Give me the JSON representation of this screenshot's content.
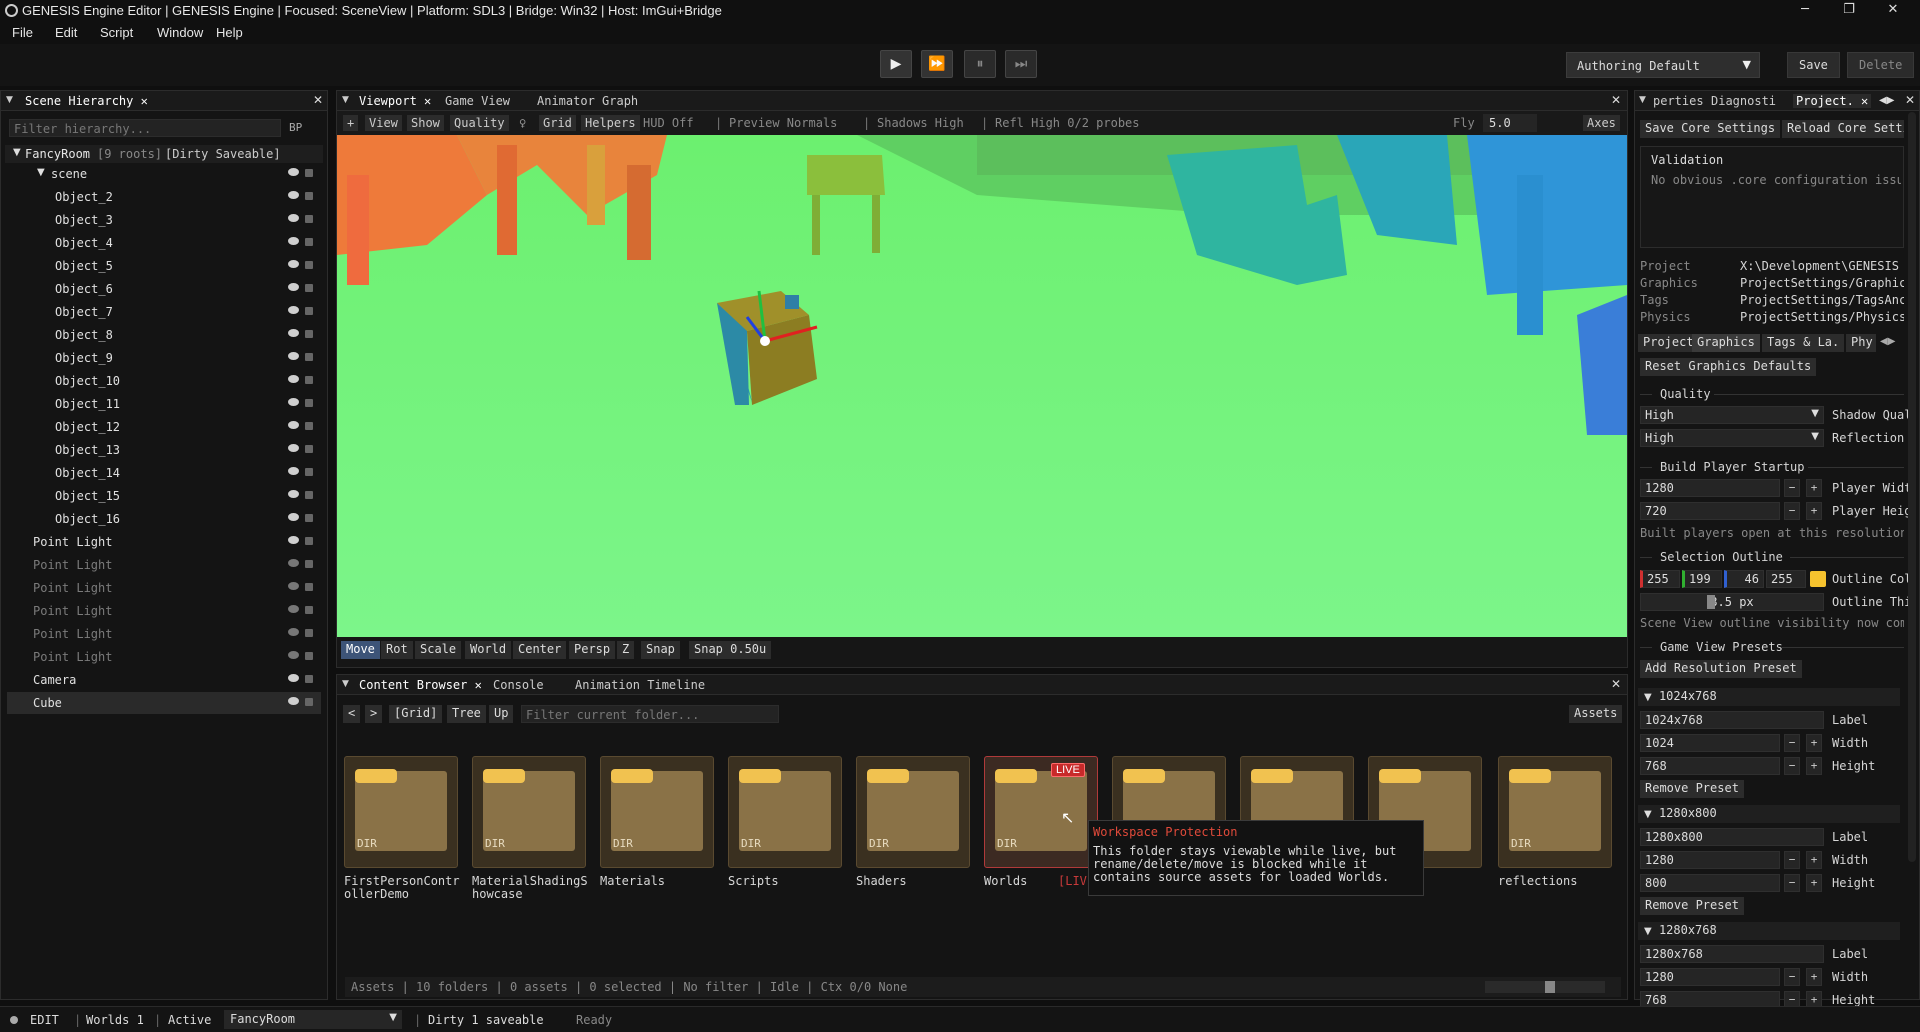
{
  "window": {
    "title": "GENESIS Engine Editor | GENESIS Engine | Focused: SceneView | Platform: SDL3 | Bridge: Win32 | Host: ImGui+Bridge",
    "min": "─",
    "max": "❐",
    "close": "✕"
  },
  "menu": [
    "File",
    "Edit",
    "Script",
    "Window",
    "Help"
  ],
  "toolbar": {
    "play": "▶",
    "fast_forward": "⏩",
    "pause": "⏸",
    "step": "⏭",
    "authoring_profile": "Authoring Default",
    "save": "Save",
    "delete": "Delete"
  },
  "hierarchy": {
    "tab": "Scene Hierarchy",
    "filter_placeholder": "Filter hierarchy...",
    "bp": "BP",
    "root": {
      "name": "FancyRoom",
      "roots": "[9 roots]",
      "state": "[Dirty Saveable]"
    },
    "scene": "scene",
    "objects": [
      "Object_2",
      "Object_3",
      "Object_4",
      "Object_5",
      "Object_6",
      "Object_7",
      "Object_8",
      "Object_9",
      "Object_10",
      "Object_11",
      "Object_12",
      "Object_13",
      "Object_14",
      "Object_15",
      "Object_16"
    ],
    "lights": [
      "Point Light",
      "Point Light",
      "Point Light",
      "Point Light",
      "Point Light",
      "Point Light"
    ],
    "camera": "Camera",
    "cube": "Cube"
  },
  "viewport": {
    "tabs": [
      "Viewport",
      "Game View",
      "Animator Graph"
    ],
    "bar": [
      "+",
      "View",
      "Show",
      "Quality",
      "Grid",
      "Helpers",
      "HUD Off",
      "Preview Normals",
      "Shadows High",
      "Refl High 0/2 probes"
    ],
    "fly_label": "Fly",
    "fly_value": "5.0",
    "axes": "Axes",
    "gizmo_tools": [
      "Move",
      "Rot",
      "Scale",
      "World",
      "Center",
      "Persp",
      "Z",
      "Snap",
      "Snap 0.50u"
    ]
  },
  "content": {
    "tabs": [
      "Content Browser",
      "Console",
      "Animation Timeline"
    ],
    "nav": [
      "<",
      ">",
      "[Grid]",
      "Tree",
      "Up"
    ],
    "filter_placeholder": "Filter current folder...",
    "assets_btn": "Assets",
    "folders": [
      {
        "name": "FirstPersonContr",
        "name2": "ollerDemo"
      },
      {
        "name": "MaterialShadingS",
        "name2": "howcase"
      },
      {
        "name": "Materials",
        "name2": ""
      },
      {
        "name": "Scripts",
        "name2": ""
      },
      {
        "name": "Shaders",
        "name2": ""
      },
      {
        "name": "Worlds",
        "name2": ""
      },
      {
        "name": "",
        "name2": ""
      },
      {
        "name": "",
        "name2": ""
      },
      {
        "name": "",
        "name2": ""
      },
      {
        "name": "reflections",
        "name2": ""
      }
    ],
    "dir_label": "DIR",
    "live_badge": "LIVE",
    "live_suffix": "[LIV",
    "tooltip": {
      "title": "Workspace Protection",
      "l1": "This folder stays viewable while live, but",
      "l2": "rename/delete/move is blocked while it",
      "l3": "contains source assets for loaded Worlds."
    },
    "status": "Assets | 10 folders | 0 assets | 0 selected | No filter | Idle | Ctx 0/0 None"
  },
  "inspector": {
    "tabs": [
      "perties",
      "Diagnosti",
      "Project."
    ],
    "save_core": "Save Core Settings",
    "reload_core": "Reload Core Setti",
    "validation": "Validation",
    "validation_msg": "No obvious .core configuration issu",
    "paths": [
      {
        "k": "Project",
        "v": "X:\\Development\\GENESIS"
      },
      {
        "k": "Graphics",
        "v": "ProjectSettings/Graphic"
      },
      {
        "k": "Tags",
        "v": "ProjectSettings/TagsAnc"
      },
      {
        "k": "Physics",
        "v": "ProjectSettings/Physics"
      }
    ],
    "subtabs": [
      "Project",
      "Graphics",
      "Tags & La.",
      "Phy"
    ],
    "reset_graphics": "Reset Graphics Defaults",
    "quality": "Quality",
    "shadow_q": "High",
    "shadow_q_label": "Shadow Qual",
    "refl_q": "High",
    "refl_q_label": "Reflection",
    "build": "Build Player Startup",
    "w": "1280",
    "w_label": "Player Widt",
    "h": "720",
    "h_label": "Player Heig",
    "build_note": "Built players open at this resolution",
    "outline": "Selection Outline",
    "r": "255",
    "g": "199",
    "b": "46",
    "a": "255",
    "outline_color_label": "Outline Col",
    "outline_color": "#f5c22e",
    "thickness": "3.5 px",
    "thickness_label": "Outline Thi",
    "outline_note": "Scene View outline visibility now come",
    "presets": "Game View Presets",
    "add_preset": "Add Resolution Preset",
    "preset_list": [
      {
        "name": "1024x768",
        "label": "1024x768",
        "w": "1024",
        "h": "768"
      },
      {
        "name": "1280x800",
        "label": "1280x800",
        "w": "1280",
        "h": "800"
      },
      {
        "name": "1280x768",
        "label": "1280x768",
        "w": "1280",
        "h": "768"
      }
    ],
    "label_lbl": "Label",
    "width_lbl": "Width",
    "height_lbl": "Height",
    "remove": "Remove Preset"
  },
  "statusbar": {
    "mode": "EDIT",
    "worlds": "Worlds 1",
    "active": "Active",
    "world_sel": "FancyRoom",
    "dirty": "Dirty 1 saveable",
    "ready": "Ready"
  }
}
